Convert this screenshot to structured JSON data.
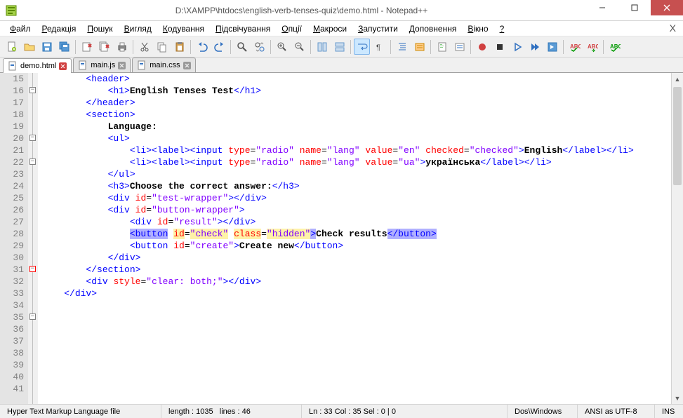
{
  "window": {
    "title": "D:\\XAMPP\\htdocs\\english-verb-tenses-quiz\\demo.html - Notepad++"
  },
  "menu": {
    "items": [
      "Файл",
      "Редакція",
      "Пошук",
      "Вигляд",
      "Кодування",
      "Підсвічування",
      "Опції",
      "Макроси",
      "Запустити",
      "Доповнення",
      "Вікно",
      "?"
    ]
  },
  "tabs": [
    {
      "label": "demo.html",
      "active": true
    },
    {
      "label": "main.js",
      "active": false
    },
    {
      "label": "main.css",
      "active": false
    }
  ],
  "editor": {
    "first_line": 15,
    "highlight_line": 33,
    "lines": [
      "",
      "        <header>",
      "            <h1>English Tenses Test</h1>",
      "        </header>",
      "",
      "        <section>",
      "            Language:",
      "            <ul>",
      "                <li><label><input type=\"radio\" name=\"lang\" value=\"en\" checked=\"checked\">English</label></li>",
      "                <li><label><input type=\"radio\" name=\"lang\" value=\"ua\">українська</label></li>",
      "            </ul>",
      "",
      "            <h3>Choose the correct answer:</h3>",
      "",
      "            <div id=\"test-wrapper\"></div>",
      "",
      "            <div id=\"button-wrapper\">",
      "                <div id=\"result\"></div>",
      "                <button id=\"check\" class=\"hidden\">Check results</button>",
      "                <button id=\"create\">Create new</button>",
      "            </div>",
      "",
      "        </section>",
      "",
      "        <div style=\"clear: both;\"></div>",
      "",
      "    </div>"
    ]
  },
  "status": {
    "filetype": "Hyper Text Markup Language file",
    "length": "length : 1035",
    "lines": "lines : 46",
    "pos": "Ln : 33   Col : 35   Sel : 0 | 0",
    "eol": "Dos\\Windows",
    "encoding": "ANSI as UTF-8",
    "mode": "INS"
  }
}
